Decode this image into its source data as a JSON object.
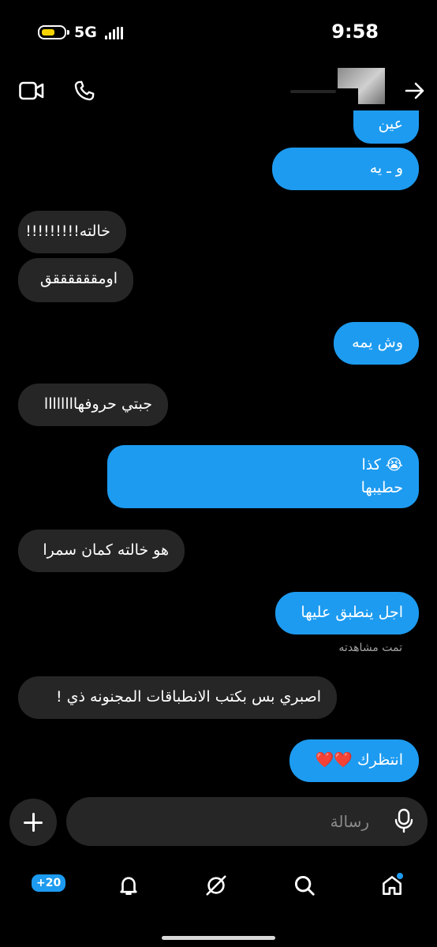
{
  "status_bar": {
    "network": "5G",
    "time": "9:58"
  },
  "header": {
    "contact_name": ""
  },
  "messages": [
    {
      "text": "عين",
      "direction": "outgoing"
    },
    {
      "text": "و ـ يه",
      "direction": "outgoing"
    },
    {
      "text": "خالته!!!!!!!!!",
      "direction": "incoming"
    },
    {
      "text": "اومققققققق",
      "direction": "incoming"
    },
    {
      "text": "وش يمه",
      "direction": "outgoing"
    },
    {
      "text": "جبتي حروفهاااااااا",
      "direction": "incoming"
    },
    {
      "text_line1": "😭 كذا",
      "text_line2": "حطيبها",
      "direction": "outgoing"
    },
    {
      "text": "هو خالته كمان سمرا",
      "direction": "incoming"
    },
    {
      "text": "اجل ينطبق عليها",
      "direction": "outgoing"
    },
    {
      "text": "اصبري بس بكتب الانطباقات المجنونه ذي !",
      "direction": "incoming"
    },
    {
      "text": "انتظرك ❤️❤️",
      "direction": "outgoing"
    }
  ],
  "seen_status": "تمت مشاهدته",
  "composer": {
    "placeholder": "رسالة"
  },
  "nav": {
    "badge_count": "+20"
  },
  "colors": {
    "outgoing_bubble": "#1d9bf0",
    "incoming_bubble": "#262626",
    "background": "#000000"
  },
  "icons": [
    "video-call-icon",
    "phone-call-icon",
    "back-arrow-icon",
    "plus-icon",
    "microphone-icon",
    "home-icon",
    "search-icon",
    "explore-icon",
    "notifications-icon",
    "messages-icon"
  ]
}
